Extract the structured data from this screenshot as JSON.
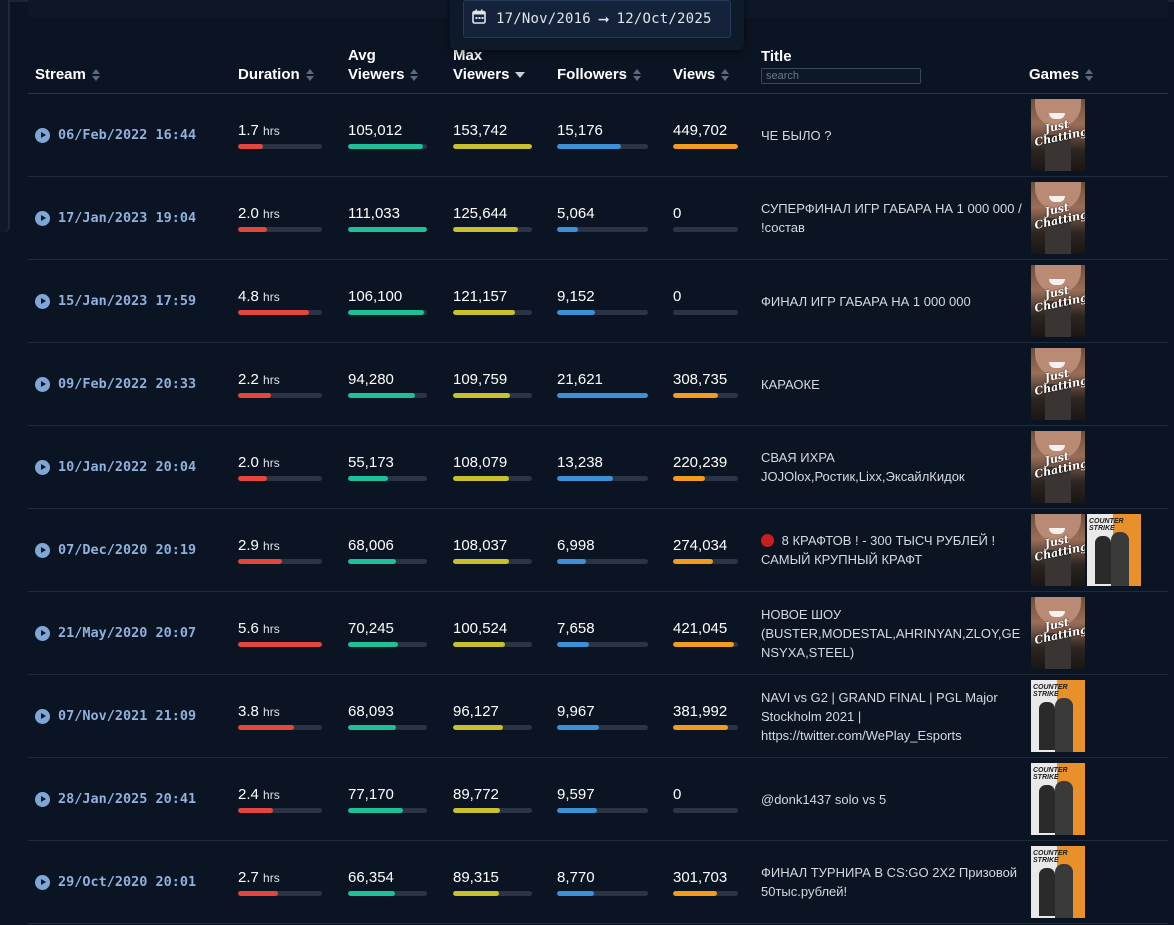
{
  "date_range": {
    "start": "17/Nov/2016",
    "end": "12/Oct/2025"
  },
  "columns": {
    "stream": "Stream",
    "duration": "Duration",
    "avg_viewers_1": "Avg",
    "avg_viewers_2": "Viewers",
    "max_viewers_1": "Max",
    "max_viewers_2": "Viewers",
    "followers": "Followers",
    "views": "Views",
    "title": "Title",
    "games": "Games"
  },
  "search": {
    "placeholder": "search"
  },
  "colors": {
    "duration": "#e3463c",
    "avg_viewers": "#1fbf9a",
    "max_viewers": "#c9c02e",
    "followers": "#3d8fd6",
    "views": "#f29b1c",
    "track": "#2a3444"
  },
  "unit_hrs": "hrs",
  "rows": [
    {
      "stream": "06/Feb/2022 16:44",
      "duration": "1.7",
      "avg": "105,012",
      "max": "153,742",
      "followers": "15,176",
      "views": "449,702",
      "title": "ЧЕ БЫЛО ?",
      "live_dot": false,
      "games": [
        "Just Chatting"
      ],
      "fill": {
        "duration": 0.3,
        "avg": 0.95,
        "max": 1.0,
        "followers": 0.7,
        "views": 1.0
      }
    },
    {
      "stream": "17/Jan/2023 19:04",
      "duration": "2.0",
      "avg": "111,033",
      "max": "125,644",
      "followers": "5,064",
      "views": "0",
      "title": "СУПЕРФИНАЛ ИГР ГАБАРА НА 1 000 000 / !состав",
      "live_dot": false,
      "games": [
        "Just Chatting"
      ],
      "fill": {
        "duration": 0.35,
        "avg": 1.0,
        "max": 0.82,
        "followers": 0.23,
        "views": 0
      }
    },
    {
      "stream": "15/Jan/2023 17:59",
      "duration": "4.8",
      "avg": "106,100",
      "max": "121,157",
      "followers": "9,152",
      "views": "0",
      "title": "ФИНАЛ ИГР ГАБАРА НА 1 000 000",
      "live_dot": false,
      "games": [
        "Just Chatting"
      ],
      "fill": {
        "duration": 0.85,
        "avg": 0.96,
        "max": 0.79,
        "followers": 0.42,
        "views": 0
      }
    },
    {
      "stream": "09/Feb/2022 20:33",
      "duration": "2.2",
      "avg": "94,280",
      "max": "109,759",
      "followers": "21,621",
      "views": "308,735",
      "title": "КАРАОКЕ",
      "live_dot": false,
      "games": [
        "Just Chatting"
      ],
      "fill": {
        "duration": 0.39,
        "avg": 0.85,
        "max": 0.72,
        "followers": 1.0,
        "views": 0.69
      }
    },
    {
      "stream": "10/Jan/2022 20:04",
      "duration": "2.0",
      "avg": "55,173",
      "max": "108,079",
      "followers": "13,238",
      "views": "220,239",
      "title": "СВАЯ ИХРА JOJOlox,Ростик,Lixx,ЭксайлКидок",
      "live_dot": false,
      "games": [
        "Just Chatting"
      ],
      "fill": {
        "duration": 0.35,
        "avg": 0.5,
        "max": 0.71,
        "followers": 0.61,
        "views": 0.49
      }
    },
    {
      "stream": "07/Dec/2020 20:19",
      "duration": "2.9",
      "avg": "68,006",
      "max": "108,037",
      "followers": "6,998",
      "views": "274,034",
      "title": "8 КРАФТОВ ! - 300 ТЫСЧ РУБЛЕЙ ! САМЫЙ КРУПНЫЙ КРАФТ",
      "live_dot": true,
      "games": [
        "Just Chatting",
        "Counter-Strike"
      ],
      "fill": {
        "duration": 0.52,
        "avg": 0.61,
        "max": 0.71,
        "followers": 0.32,
        "views": 0.61
      }
    },
    {
      "stream": "21/May/2020 20:07",
      "duration": "5.6",
      "avg": "70,245",
      "max": "100,524",
      "followers": "7,658",
      "views": "421,045",
      "title": "НОВОЕ ШОУ (BUSTER,MODESTAL,AHRINYAN,ZLOY,GENSYXA,STEEL)",
      "live_dot": false,
      "games": [
        "Just Chatting"
      ],
      "fill": {
        "duration": 1.0,
        "avg": 0.63,
        "max": 0.66,
        "followers": 0.35,
        "views": 0.94
      }
    },
    {
      "stream": "07/Nov/2021 21:09",
      "duration": "3.8",
      "avg": "68,093",
      "max": "96,127",
      "followers": "9,967",
      "views": "381,992",
      "title": "NAVI vs G2 | GRAND FINAL | PGL Major Stockholm 2021 | https://twitter.com/WePlay_Esports",
      "live_dot": false,
      "games": [
        "Counter-Strike"
      ],
      "fill": {
        "duration": 0.67,
        "avg": 0.61,
        "max": 0.63,
        "followers": 0.46,
        "views": 0.85
      }
    },
    {
      "stream": "28/Jan/2025 20:41",
      "duration": "2.4",
      "avg": "77,170",
      "max": "89,772",
      "followers": "9,597",
      "views": "0",
      "title": "@donk1437 solo vs 5",
      "live_dot": false,
      "games": [
        "Counter-Strike"
      ],
      "fill": {
        "duration": 0.42,
        "avg": 0.69,
        "max": 0.59,
        "followers": 0.44,
        "views": 0
      }
    },
    {
      "stream": "29/Oct/2020 20:01",
      "duration": "2.7",
      "avg": "66,354",
      "max": "89,315",
      "followers": "8,770",
      "views": "301,703",
      "title": "ФИНАЛ ТУРНИРА В CS:GO 2X2 Призовой 50тыс.рублей!",
      "live_dot": false,
      "games": [
        "Counter-Strike"
      ],
      "fill": {
        "duration": 0.48,
        "avg": 0.6,
        "max": 0.58,
        "followers": 0.41,
        "views": 0.67
      }
    }
  ]
}
